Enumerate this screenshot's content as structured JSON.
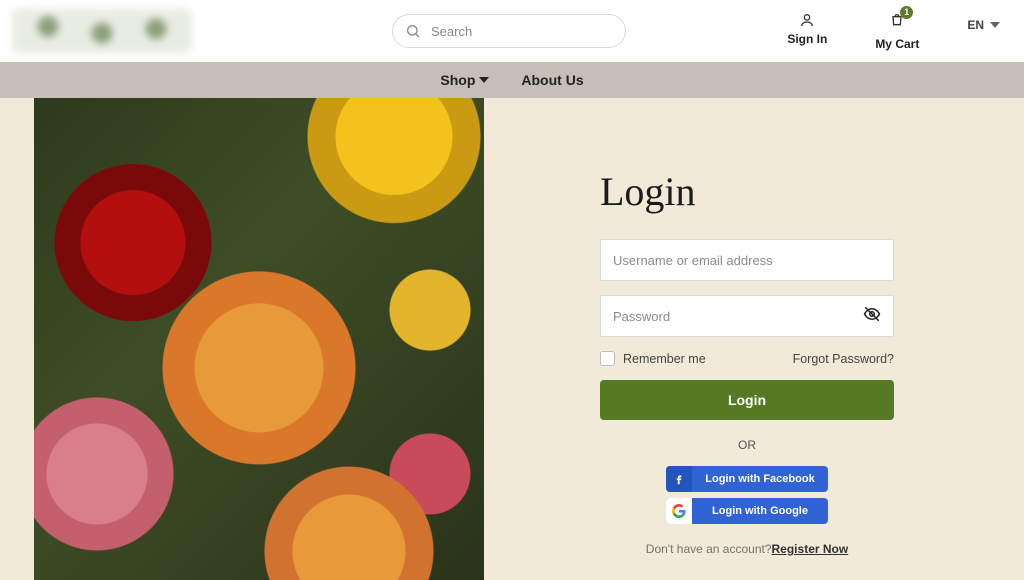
{
  "header": {
    "search_placeholder": "Search",
    "signin_label": "Sign In",
    "cart_label": "My Cart",
    "cart_count": "1",
    "lang_label": "EN"
  },
  "nav": {
    "shop_label": "Shop",
    "about_label": "About Us"
  },
  "login": {
    "title": "Login",
    "username_placeholder": "Username or email address",
    "password_placeholder": "Password",
    "remember_label": "Remember me",
    "forgot_label": "Forgot Password?",
    "button_label": "Login",
    "or_label": "OR",
    "fb_label": "Login with Facebook",
    "gg_label": "Login with Google",
    "noacc_text": "Don't have an account?",
    "register_label": "Register Now"
  }
}
